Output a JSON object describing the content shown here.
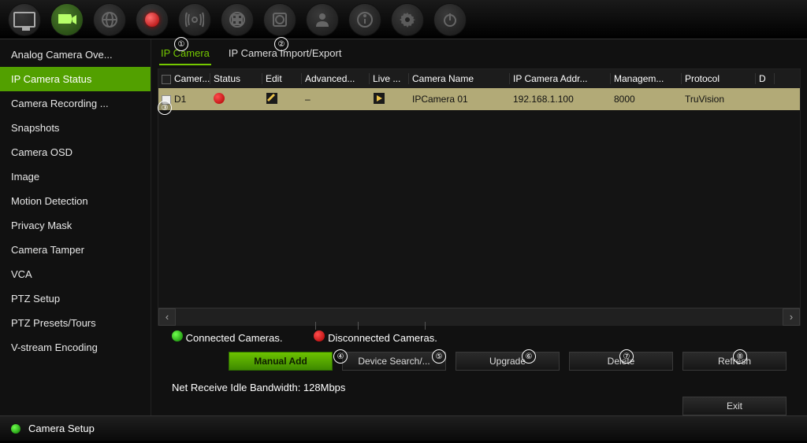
{
  "sidebar": {
    "items": [
      {
        "label": "Analog Camera Ove..."
      },
      {
        "label": "IP Camera Status"
      },
      {
        "label": "Camera Recording ..."
      },
      {
        "label": "Snapshots"
      },
      {
        "label": "Camera OSD"
      },
      {
        "label": "Image"
      },
      {
        "label": "Motion Detection"
      },
      {
        "label": "Privacy Mask"
      },
      {
        "label": "Camera Tamper"
      },
      {
        "label": "VCA"
      },
      {
        "label": "PTZ Setup"
      },
      {
        "label": "PTZ Presets/Tours"
      },
      {
        "label": "V-stream Encoding"
      }
    ],
    "active_index": 1
  },
  "tabs": [
    {
      "label": "IP Camera"
    },
    {
      "label": "IP Camera Import/Export"
    }
  ],
  "active_tab": 0,
  "table": {
    "headers": [
      "Camer...",
      "Status",
      "Edit",
      "Advanced...",
      "Live ...",
      "Camera Name",
      "IP Camera Addr...",
      "Managem...",
      "Protocol",
      "D"
    ],
    "row": {
      "camera": "D1",
      "name": "IPCamera 01",
      "addr": "192.168.1.100",
      "mgmt": "8000",
      "protocol": "TruVision",
      "advanced": "–"
    }
  },
  "legend": {
    "connected": "Connected Cameras.",
    "disconnected": "Disconnected Cameras."
  },
  "buttons": {
    "manual_add": "Manual Add",
    "device_search": "Device Search/...",
    "upgrade": "Upgrade",
    "delete": "Delete",
    "refresh": "Refresh",
    "exit": "Exit"
  },
  "status_line": "Net Receive Idle Bandwidth: 128Mbps",
  "bottombar": "Camera Setup",
  "callouts": [
    "①",
    "②",
    "③",
    "④",
    "⑤",
    "⑥",
    "⑦",
    "⑧"
  ]
}
